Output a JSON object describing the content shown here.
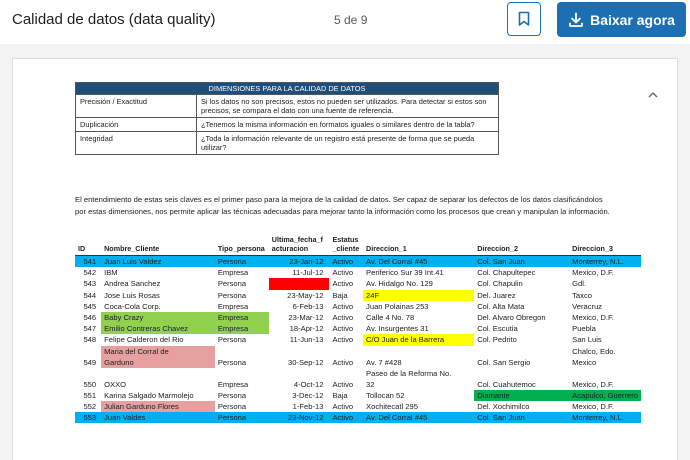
{
  "header": {
    "title": "Calidad de datos (data quality)",
    "page_indicator": "5 de 9",
    "download_label": "Baixar agora"
  },
  "dimensions_table": {
    "title": "DIMENSIONES PARA LA CALIDAD DE DATOS",
    "rows": [
      {
        "name": "Precisión / Exactitud",
        "desc": "Si los datos no son precisos, estos no pueden ser utilizados. Para detectar si estos son precisos, se compara el dato con una fuente de referencia."
      },
      {
        "name": "Duplicación",
        "desc": "¿Tenemos la misma información en formatos iguales o similares dentro de la tabla?"
      },
      {
        "name": "Integridad",
        "desc": "¿Toda la información relevante de un registro está presente de forma que se pueda utilizar?"
      }
    ]
  },
  "paragraph": "El entendimiento de estas seis claves es el primer paso para la mejora de la calidad de datos. Ser capaz de separar los defectos de los datos clasificándolos por estas dimensiones, nos permite aplicar las técnicas adecuadas para mejorar tanto la información como los procesos que crean y manipulan la información.",
  "data_table": {
    "headers": [
      "ID",
      "Nombre_Cliente",
      "Tipo_persona",
      "Ultima_fecha_facturacion",
      "Estatus_cliente",
      "Direccion_1",
      "Direccion_2",
      "Direccion_3"
    ],
    "rows": [
      {
        "id": "541",
        "nombre": "Juan Luis Valdez",
        "tipo": "Persona",
        "fecha": "23-Jan-12",
        "estatus": "Activo",
        "dir1": "Av. Del Corral #45",
        "dir2": "Col. San Juan",
        "dir3": "Monterrey, N.L."
      },
      {
        "id": "542",
        "nombre": "IBM",
        "tipo": "Empresa",
        "fecha": "11-Jul-12",
        "estatus": "Activo",
        "dir1": "Periferico Sur 39 Int.41",
        "dir2": "Col. Chapultepec",
        "dir3": "Mexico, D.F."
      },
      {
        "id": "543",
        "nombre": "Andrea Sanchez",
        "tipo": "Persona",
        "fecha": "",
        "estatus": "Activo",
        "dir1": "Av. Hidalgo No. 129",
        "dir2": "Col. Chapulin",
        "dir3": "Gdl."
      },
      {
        "id": "544",
        "nombre": "Jose Luis Rosas",
        "tipo": "Persona",
        "fecha": "23-May-12",
        "estatus": "Baja",
        "dir1": "24F",
        "dir2": "Del. Juarez",
        "dir3": "Taxco"
      },
      {
        "id": "545",
        "nombre": "Coca-Cola Corp.",
        "tipo": "Empresa",
        "fecha": "6-Feb-13",
        "estatus": "Activo",
        "dir1": "Juan Polainas 253",
        "dir2": "Col. Alta Mata",
        "dir3": "Veracruz"
      },
      {
        "id": "546",
        "nombre": "Baby Crazy",
        "tipo": "Empresa",
        "fecha": "23-Mar-12",
        "estatus": "Activo",
        "dir1": "Calle 4 No. 78",
        "dir2": "Del. Alvaro Obregon",
        "dir3": "Mexico, D.F."
      },
      {
        "id": "547",
        "nombre": "Emilio Contreras Chavez",
        "tipo": "Empresa",
        "fecha": "18-Apr-12",
        "estatus": "Activo",
        "dir1": "Av. Insurgentes 31",
        "dir2": "Col. Escutia",
        "dir3": "Puebla"
      },
      {
        "id": "548",
        "nombre": "Felipe Calderon del Rio",
        "tipo": "Persona",
        "fecha": "11-Jun-13",
        "estatus": "Activo",
        "dir1": "C/O Juan de la Barrera",
        "dir2": "Col. Pedrito",
        "dir3": "San Luis"
      },
      {
        "id": "549",
        "nombre_line1": "Maria del Corral de",
        "nombre_line2": "Garduno",
        "tipo": "Persona",
        "fecha": "30-Sep-12",
        "estatus": "Activo",
        "dir1": "Av. 7 #428",
        "dir2": "Col. San Sergio",
        "dir3_line1": "Chalco, Edo.",
        "dir3_line2": "Mexico"
      },
      {
        "id": "550",
        "nombre": "OXXO",
        "tipo": "Empresa",
        "fecha": "4-Oct-12",
        "estatus": "Activo",
        "dir1_line1": "Paseo de la Reforma No.",
        "dir1_line2": "32",
        "dir2": "Col. Cuahutemoc",
        "dir3": "Mexico, D.F."
      },
      {
        "id": "551",
        "nombre": "Karina Salgado Marmolejo",
        "tipo": "Persona",
        "fecha": "3-Dec-12",
        "estatus": "Baja",
        "dir1": "Tollocan 52",
        "dir2": "Diamante",
        "dir3": "Acapulco, Guerrero"
      },
      {
        "id": "552",
        "nombre": "Julian Garduno Flores",
        "tipo": "Persona",
        "fecha": "1-Feb-13",
        "estatus": "Activo",
        "dir1": "Xochitecatl 295",
        "dir2": "Del. Xochimilco",
        "dir3": "Mexico, D.F."
      },
      {
        "id": "553",
        "nombre": "Juan  Valdes",
        "tipo": "Persona",
        "fecha": "23-Nov-12",
        "estatus": "Activo",
        "dir1": "Av. Del Corral #45",
        "dir2": "Col. San Juan",
        "dir3": "Monterrey, N.L."
      }
    ]
  },
  "colors": {
    "brand_blue": "#1c6fb3",
    "table_header": "#1f4e79",
    "highlight_blue": "#00b0f0",
    "highlight_green": "#92d050",
    "highlight_yellow": "#ffff00",
    "highlight_red": "#ff0000",
    "highlight_pink": "#e6a0a0",
    "highlight_dark_green": "#00b050"
  },
  "icons": [
    "bookmark-icon",
    "download-icon",
    "collapse-icon"
  ]
}
